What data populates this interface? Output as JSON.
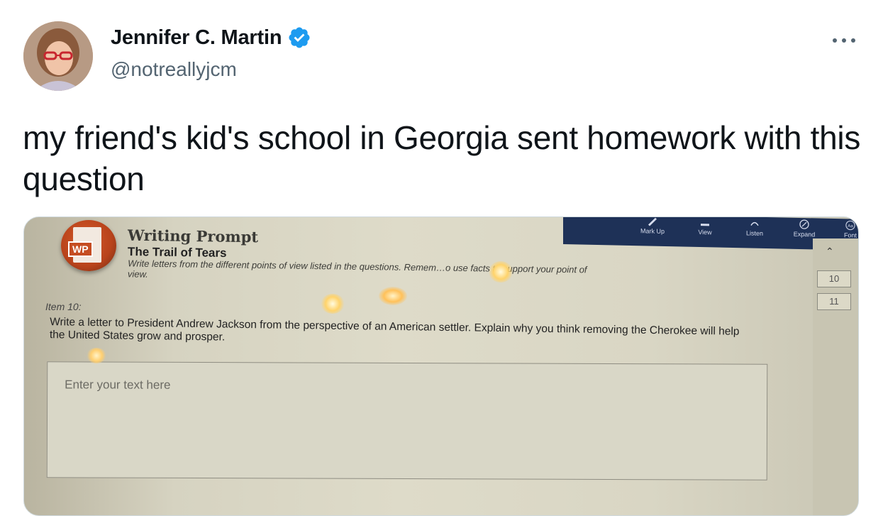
{
  "author": {
    "name": "Jennifer C. Martin",
    "handle": "@notreallyjcm",
    "verified": true
  },
  "tweet": {
    "text": "my friend's kid's school in Georgia sent homework with this question"
  },
  "photo": {
    "toolbar": [
      {
        "label": "Mark Up",
        "icon": "pencil-icon"
      },
      {
        "label": "View",
        "icon": "view-icon"
      },
      {
        "label": "Listen",
        "icon": "listen-icon"
      },
      {
        "label": "Expand",
        "icon": "expand-icon"
      },
      {
        "label": "Font",
        "icon": "font-icon"
      }
    ],
    "font_icon_text": "Aa",
    "logo_text": "WP",
    "prompt_title": "Writing Prompt",
    "prompt_subtitle": "The Trail of Tears",
    "prompt_instructions": "Write letters from the different points of view listed in the questions. Remem…o use facts to support your point of view.",
    "item_label": "Item 10:",
    "question": "Write a letter to President Andrew Jackson from the perspective of an American settler. Explain why you think removing the Cherokee will help the United States grow and prosper.",
    "answer_placeholder": "Enter your text here",
    "pages": [
      "10",
      "11"
    ],
    "colors": {
      "toolbar": "#1e3157",
      "logo": "#c54d22",
      "verified": "#1d9bf0"
    }
  }
}
